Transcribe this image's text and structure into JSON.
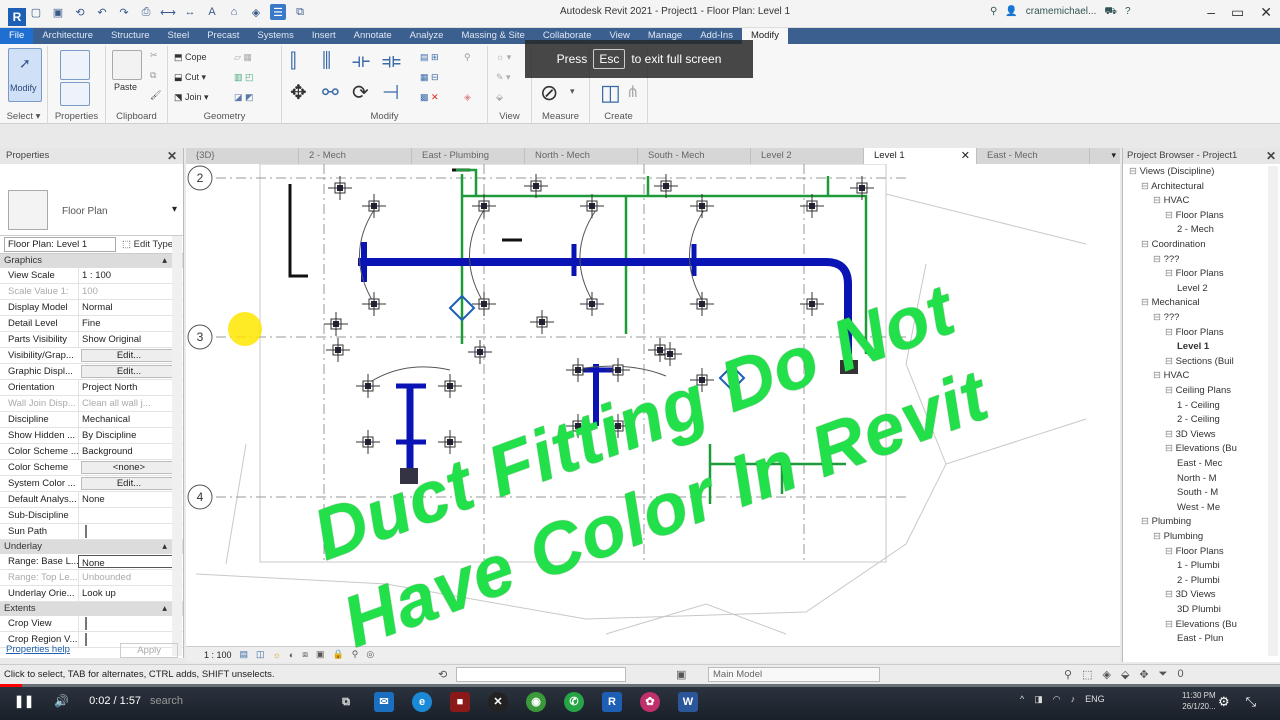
{
  "window": {
    "title": "Autodesk Revit 2021 - Project1 - Floor Plan: Level 1",
    "user": "cramemichael...",
    "logo": "R"
  },
  "ribbon_tabs": [
    "File",
    "Architecture",
    "Structure",
    "Steel",
    "Precast",
    "Systems",
    "Insert",
    "Annotate",
    "Analyze",
    "Massing & Site",
    "Collaborate",
    "View",
    "Manage",
    "Add-Ins",
    "Modify"
  ],
  "ribbon": {
    "modify_label": "Modify",
    "select_label": "Select",
    "properties_label": "Properties",
    "clipboard_label": "Clipboard",
    "paste_label": "Paste",
    "geometry_label": "Geometry",
    "cope_label": "Cope",
    "cut_label": "Cut",
    "join_label": "Join",
    "modify_panel_label": "Modify",
    "view_label": "View",
    "measure_label": "Measure",
    "create_label": "Create"
  },
  "toast": {
    "press": "Press",
    "key": "Esc",
    "message": "to exit full screen"
  },
  "properties": {
    "header": "Properties",
    "type_name": "Floor Plan",
    "instance": "Floor Plan: Level 1",
    "edit_type": "Edit Type",
    "sections": {
      "graphics": "Graphics",
      "underlay": "Underlay",
      "extents": "Extents"
    },
    "graphics_rows": [
      {
        "name": "View Scale",
        "value": "1 : 100"
      },
      {
        "name": "Scale Value    1:",
        "value": "100"
      },
      {
        "name": "Display Model",
        "value": "Normal"
      },
      {
        "name": "Detail Level",
        "value": "Fine"
      },
      {
        "name": "Parts Visibility",
        "value": "Show Original"
      },
      {
        "name": "Visibility/Grap...",
        "value": "Edit..."
      },
      {
        "name": "Graphic Displ...",
        "value": "Edit..."
      },
      {
        "name": "Orientation",
        "value": "Project North"
      },
      {
        "name": "Wall Join Disp...",
        "value": "Clean all wall j..."
      },
      {
        "name": "Discipline",
        "value": "Mechanical"
      },
      {
        "name": "Show Hidden ...",
        "value": "By Discipline"
      },
      {
        "name": "Color Scheme ...",
        "value": "Background"
      },
      {
        "name": "Color Scheme",
        "value": "<none>"
      },
      {
        "name": "System Color ...",
        "value": "Edit..."
      },
      {
        "name": "Default Analys...",
        "value": "None"
      },
      {
        "name": "Sub-Discipline",
        "value": ""
      },
      {
        "name": "Sun Path",
        "value": ""
      }
    ],
    "underlay_rows": [
      {
        "name": "Range: Base L...",
        "value": "None"
      },
      {
        "name": "Range: Top Le...",
        "value": "Unbounded"
      },
      {
        "name": "Underlay Orie...",
        "value": "Look up"
      }
    ],
    "extents_rows": [
      {
        "name": "Crop View",
        "value": ""
      },
      {
        "name": "Crop Region V...",
        "value": ""
      }
    ],
    "help": "Properties help",
    "apply": "Apply"
  },
  "view_tabs": [
    "{3D}",
    "2 - Mech",
    "East - Plumbing",
    "North - Mech",
    "South - Mech",
    "Level 2",
    "Level 1",
    "East - Mech"
  ],
  "grid_labels": [
    "2",
    "3",
    "4"
  ],
  "view_scale": "1 : 100",
  "browser": {
    "header": "Project Browser - Project1",
    "nodes": [
      "Views (Discipline)",
      "Architectural",
      "HVAC",
      "Floor Plans",
      "2 - Mech",
      "Coordination",
      "???",
      "Floor Plans",
      "Level 2",
      "Mechanical",
      "???",
      "Floor Plans",
      "Level 1",
      "Sections (Buil",
      "HVAC",
      "Ceiling Plans",
      "1 - Ceiling",
      "2 - Ceiling",
      "3D Views",
      "Elevations (Bu",
      "East - Mec",
      "North - M",
      "South - M",
      "West - Me",
      "Plumbing",
      "Plumbing",
      "Floor Plans",
      "1 - Plumbi",
      "2 - Plumbi",
      "3D Views",
      "3D Plumbi",
      "Elevations (Bu",
      "East - Plun"
    ]
  },
  "status": {
    "text": "Click to select, TAB for alternates, CTRL adds, SHIFT unselects.",
    "model": "Main Model",
    "filter_count": "0"
  },
  "player": {
    "time": "0:02 / 1:57",
    "search": "search",
    "progress": 0.017,
    "lang": "ENG",
    "clock_time": "11:30 PM",
    "clock_date": "26/1/20..."
  },
  "overlay": {
    "line1": "Duct Fitting Do Not",
    "line2": "Have Color In Revit"
  },
  "colors": {
    "duct_blue": "#0a14b4",
    "pipe_green": "#1e9a3a",
    "overlay_green": "#22e04a",
    "ribbon_blue": "#3b5f8f"
  }
}
